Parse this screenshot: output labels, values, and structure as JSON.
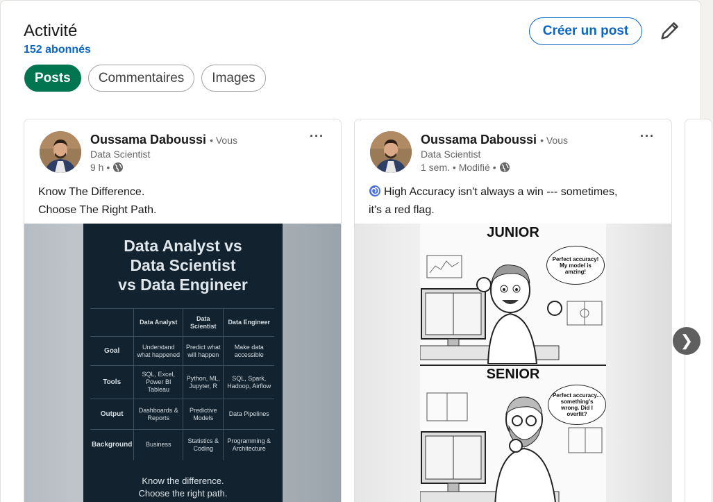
{
  "header": {
    "title": "Activité",
    "followers": "152 abonnés",
    "create_post": "Créer un post"
  },
  "tabs": [
    {
      "label": "Posts",
      "active": true
    },
    {
      "label": "Commentaires",
      "active": false
    },
    {
      "label": "Images",
      "active": false
    }
  ],
  "posts": [
    {
      "author": "Oussama Daboussi",
      "you": "• Vous",
      "role": "Data Scientist",
      "time": "9 h •",
      "text_lines": [
        "Know The Difference.",
        "Choose The Right Path."
      ],
      "infographic": {
        "title_lines": [
          "Data Analyst vs",
          "Data Scientist",
          "vs Data Engineer"
        ],
        "columns": [
          "Data Analyst",
          "Data Scientist",
          "Data Engineer"
        ],
        "rows": [
          {
            "label": "Goal",
            "cells": [
              "Understand what happened",
              "Predict what will happen",
              "Make data accessible"
            ]
          },
          {
            "label": "Tools",
            "cells": [
              "SQL, Excel, Power BI Tableau",
              "Python, ML, Jupyter, R",
              "SQL, Spark, Hadoop, Airflow"
            ]
          },
          {
            "label": "Output",
            "cells": [
              "Dashboards & Reports",
              "Predictive Models",
              "Data Pipelines"
            ]
          },
          {
            "label": "Background",
            "cells": [
              "Business",
              "Statistics & Coding",
              "Programming & Architecture"
            ]
          }
        ],
        "footer_lines": [
          "Know the difference.",
          "Choose the right path."
        ]
      }
    },
    {
      "author": "Oussama Daboussi",
      "you": "• Vous",
      "role": "Data Scientist",
      "time": "1 sem. • Modifié •",
      "text_lines": [
        "High Accuracy isn't always a win --- sometimes,",
        "it's a red flag."
      ],
      "comic": {
        "junior": "JUNIOR",
        "junior_bubble": "Perfect accuracy! My model is amzing!",
        "senior": "SENIOR",
        "senior_bubble": "Perfect accuracy... something's wrong. Did I overfit?"
      }
    }
  ],
  "icons": {
    "edit": "pencil-icon",
    "more": "ellipsis-icon",
    "visibility": "globe-icon",
    "next": "chevron-right-icon",
    "emoji": "cyclone-emoji-icon"
  },
  "colors": {
    "brand": "#0a66c2",
    "active_tab": "#01754f"
  },
  "next_label": "❯"
}
